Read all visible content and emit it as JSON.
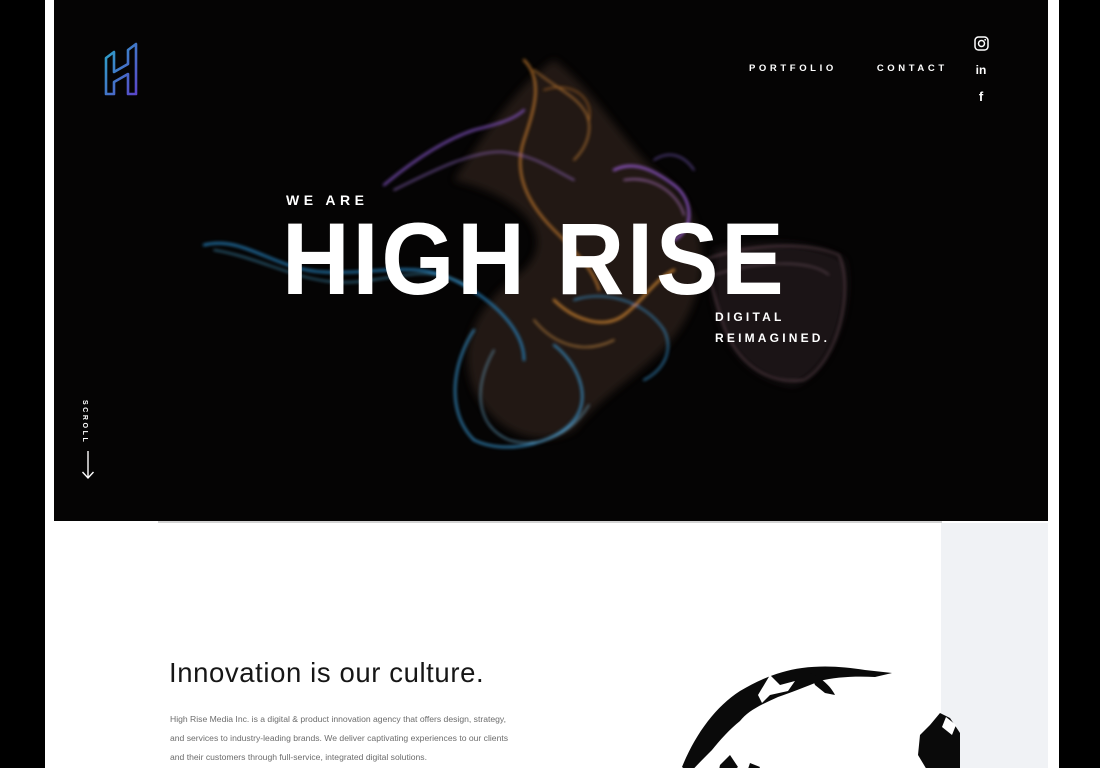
{
  "nav": {
    "items": [
      {
        "label": "PORTFOLIO"
      },
      {
        "label": "CONTACT"
      }
    ]
  },
  "social": {
    "icons": [
      "instagram-icon",
      "linkedin-icon",
      "facebook-icon"
    ],
    "linkedin_text": "in",
    "facebook_text": "f"
  },
  "hero": {
    "eyebrow": "WE ARE",
    "headline": "HIGH RISE",
    "tagline_line1": "DIGITAL",
    "tagline_line2": "REIMAGINED.",
    "scroll_label": "SCROLL"
  },
  "about": {
    "title": "Innovation is our culture.",
    "body": "High Rise Media Inc. is a digital & product innovation agency that offers design, strategy, and services to industry-leading brands. We deliver captivating experiences to our clients and their customers through full-service, integrated digital solutions."
  },
  "colors": {
    "hero_background": "#050404",
    "logo_gradient_start": "#2aa6c8",
    "logo_gradient_end": "#5a46c9",
    "side_panel": "#f0f2f5"
  }
}
